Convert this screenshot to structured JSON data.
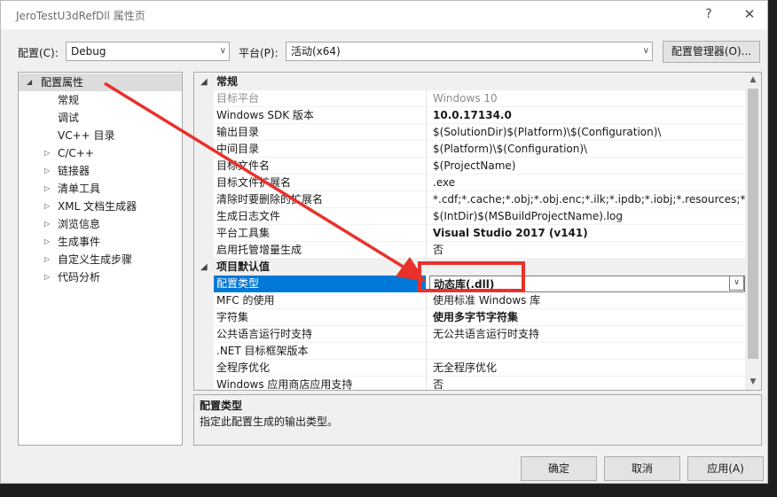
{
  "window": {
    "title": "JeroTestU3dRefDll 属性页",
    "help_glyph": "?",
    "close_glyph": "✕"
  },
  "toolbar": {
    "config_label": "配置(C):",
    "config_value": "Debug",
    "platform_label": "平台(P):",
    "platform_value": "活动(x64)",
    "config_manager_label": "配置管理器(O)..."
  },
  "tree": {
    "items": [
      {
        "label": "配置属性",
        "toggle": "◢"
      },
      {
        "label": "常规",
        "toggle": ""
      },
      {
        "label": "调试",
        "toggle": ""
      },
      {
        "label": "VC++ 目录",
        "toggle": ""
      },
      {
        "label": "C/C++",
        "toggle": "▷"
      },
      {
        "label": "链接器",
        "toggle": "▷"
      },
      {
        "label": "清单工具",
        "toggle": "▷"
      },
      {
        "label": "XML 文档生成器",
        "toggle": "▷"
      },
      {
        "label": "浏览信息",
        "toggle": "▷"
      },
      {
        "label": "生成事件",
        "toggle": "▷"
      },
      {
        "label": "自定义生成步骤",
        "toggle": "▷"
      },
      {
        "label": "代码分析",
        "toggle": "▷"
      }
    ]
  },
  "grid": {
    "categories": [
      {
        "label": "常规",
        "toggle": "◢"
      },
      {
        "label": "项目默认值",
        "toggle": "◢"
      }
    ],
    "rows": [
      {
        "name": "目标平台",
        "value": "Windows 10"
      },
      {
        "name": "Windows SDK 版本",
        "value": "10.0.17134.0"
      },
      {
        "name": "输出目录",
        "value": "$(SolutionDir)$(Platform)\\$(Configuration)\\"
      },
      {
        "name": "中间目录",
        "value": "$(Platform)\\$(Configuration)\\"
      },
      {
        "name": "目标文件名",
        "value": "$(ProjectName)"
      },
      {
        "name": "目标文件扩展名",
        "value": ".exe"
      },
      {
        "name": "清除时要删除的扩展名",
        "value": "*.cdf;*.cache;*.obj;*.obj.enc;*.ilk;*.ipdb;*.iobj;*.resources;*.tlb;*.tli;*"
      },
      {
        "name": "生成日志文件",
        "value": "$(IntDir)$(MSBuildProjectName).log"
      },
      {
        "name": "平台工具集",
        "value": "Visual Studio 2017 (v141)"
      },
      {
        "name": "启用托管增量生成",
        "value": "否"
      },
      {
        "name": "配置类型",
        "value": "动态库(.dll)"
      },
      {
        "name": "MFC 的使用",
        "value": "使用标准 Windows 库"
      },
      {
        "name": "字符集",
        "value": "使用多字节字符集"
      },
      {
        "name": "公共语言运行时支持",
        "value": "无公共语言运行时支持"
      },
      {
        "name": ".NET 目标框架版本",
        "value": ""
      },
      {
        "name": "全程序优化",
        "value": "无全程序优化"
      },
      {
        "name": "Windows 应用商店应用支持",
        "value": "否"
      }
    ],
    "dropdown_glyph": "∨",
    "scroll_up_glyph": "▲",
    "scroll_down_glyph": "▼"
  },
  "description": {
    "title": "配置类型",
    "text": "指定此配置生成的输出类型。"
  },
  "buttons": {
    "ok": "确定",
    "cancel": "取消",
    "apply": "应用(A)"
  },
  "annotation": {
    "color": "#e8312b"
  }
}
